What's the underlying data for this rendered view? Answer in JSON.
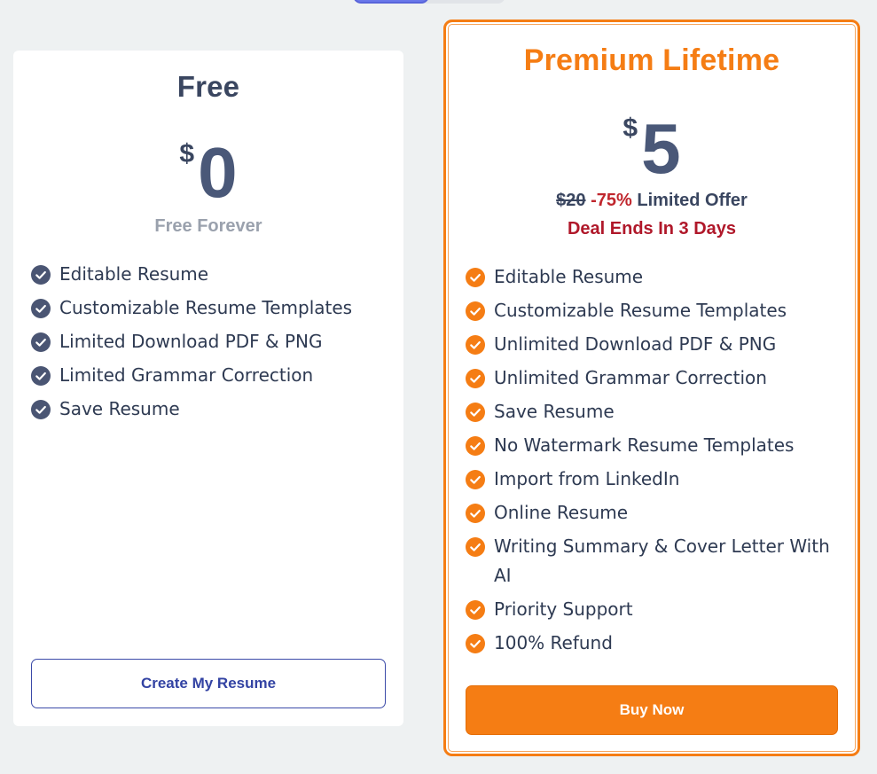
{
  "free": {
    "title": "Free",
    "currency": "$",
    "price": "0",
    "subtitle": "Free Forever",
    "features": [
      "Editable Resume",
      "Customizable Resume Templates",
      "Limited Download PDF & PNG",
      "Limited Grammar Correction",
      "Save Resume"
    ],
    "button_label": "Create My Resume"
  },
  "premium": {
    "title": "Premium Lifetime",
    "currency": "$",
    "price": "5",
    "old_price": "$20",
    "discount": "-75%",
    "offer_label": "Limited Offer",
    "deal_text": "Deal Ends In 3 Days",
    "features": [
      "Editable Resume",
      "Customizable Resume Templates",
      "Unlimited Download PDF & PNG",
      "Unlimited Grammar Correction",
      "Save Resume",
      "No Watermark Resume Templates",
      "Import from LinkedIn",
      "Online Resume",
      "Writing Summary & Cover Letter With AI",
      "Priority Support",
      "100% Refund"
    ],
    "button_label": "Buy Now"
  },
  "icons": {
    "feature_check_free": "check-circle-icon",
    "feature_check_premium": "check-circle-icon"
  },
  "colors": {
    "accent_orange": "#f57d14",
    "deal_red": "#b0182a",
    "text_dark": "#3a4660",
    "free_check": "#4a5573",
    "outline_button": "#3343a3",
    "toggle_active": "#6a78ea"
  }
}
